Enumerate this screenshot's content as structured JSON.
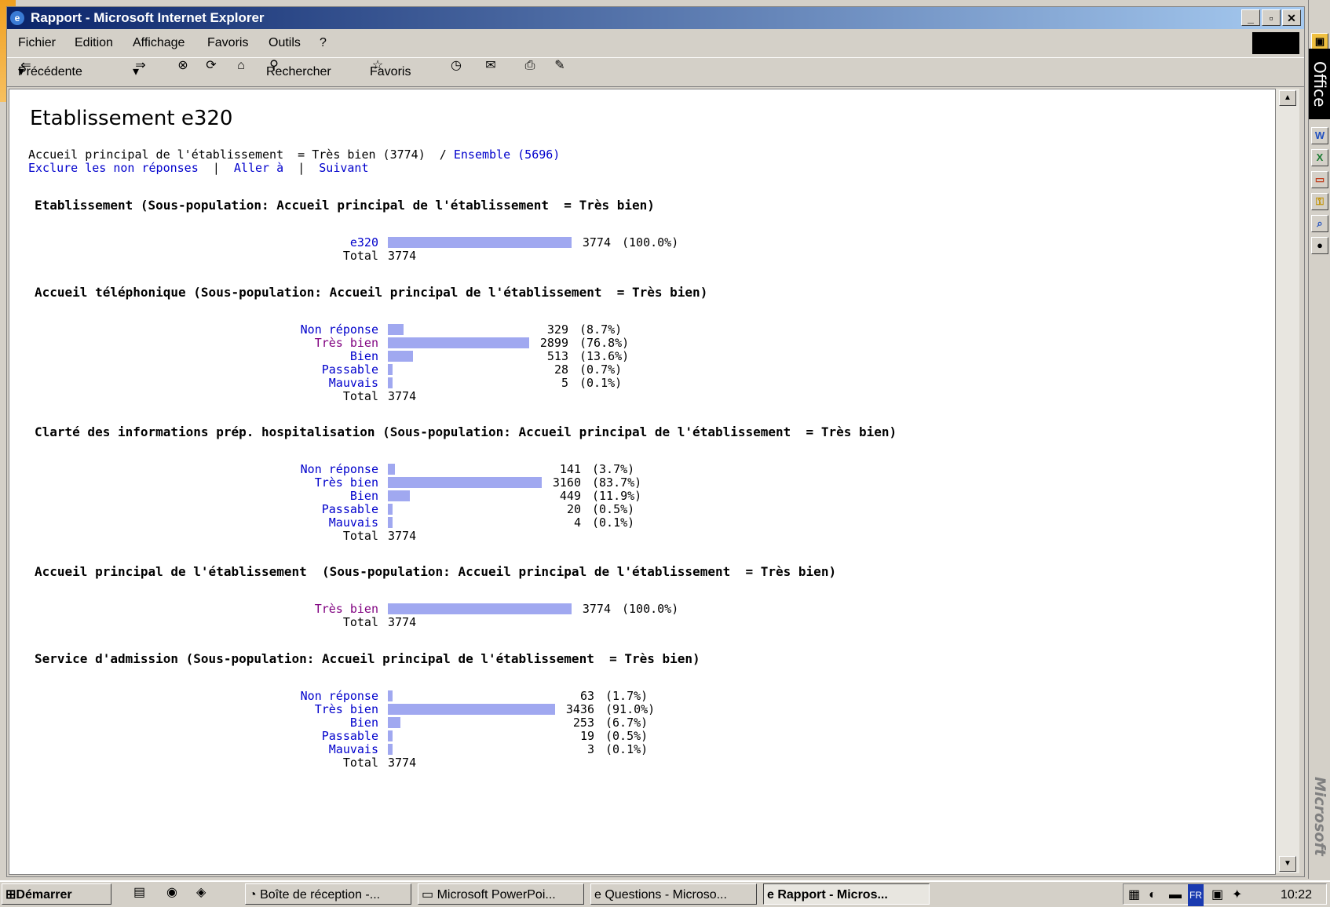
{
  "window": {
    "title": "Rapport - Microsoft Internet Explorer"
  },
  "menu": [
    "Fichier",
    "Edition",
    "Affichage",
    "Favoris",
    "Outils",
    "?"
  ],
  "toolbar": {
    "back": "Précédente",
    "search": "Rechercher",
    "favorites": "Favoris"
  },
  "report": {
    "heading": "Etablissement e320",
    "filter_text": "Accueil principal de l'établissement  = Très bien (3774)  /",
    "ensemble_link": "Ensemble (5696)",
    "links": {
      "exclude": "Exclure les non réponses",
      "sep1": "|",
      "goto": "Aller à",
      "sep2": "|",
      "next": "Suivant"
    },
    "total_label": "Total",
    "sections": [
      {
        "title": "Etablissement (Sous-population: Accueil principal de l'établissement  = Très bien)",
        "rows": [
          {
            "label": "e320",
            "count": "3774",
            "pct": "(100.0%)",
            "value": 100.0,
            "visited": false
          }
        ],
        "total": "3774"
      },
      {
        "title": "Accueil téléphonique (Sous-population: Accueil principal de l'établissement  = Très bien)",
        "rows": [
          {
            "label": "Non réponse",
            "count": "329",
            "pct": "(8.7%)",
            "value": 8.7,
            "visited": false
          },
          {
            "label": "Très bien",
            "count": "2899",
            "pct": "(76.8%)",
            "value": 76.8,
            "visited": true
          },
          {
            "label": "Bien",
            "count": "513",
            "pct": "(13.6%)",
            "value": 13.6,
            "visited": false
          },
          {
            "label": "Passable",
            "count": "28",
            "pct": "(0.7%)",
            "value": 0.7,
            "visited": false
          },
          {
            "label": "Mauvais",
            "count": "5",
            "pct": "(0.1%)",
            "value": 0.1,
            "visited": false
          }
        ],
        "total": "3774"
      },
      {
        "title": "Clarté des informations prép. hospitalisation (Sous-population: Accueil principal de l'établissement  = Très bien)",
        "rows": [
          {
            "label": "Non réponse",
            "count": "141",
            "pct": "(3.7%)",
            "value": 3.7,
            "visited": false
          },
          {
            "label": "Très bien",
            "count": "3160",
            "pct": "(83.7%)",
            "value": 83.7,
            "visited": false
          },
          {
            "label": "Bien",
            "count": "449",
            "pct": "(11.9%)",
            "value": 11.9,
            "visited": false
          },
          {
            "label": "Passable",
            "count": "20",
            "pct": "(0.5%)",
            "value": 0.5,
            "visited": false
          },
          {
            "label": "Mauvais",
            "count": "4",
            "pct": "(0.1%)",
            "value": 0.1,
            "visited": false
          }
        ],
        "total": "3774"
      },
      {
        "title": "Accueil principal de l'établissement  (Sous-population: Accueil principal de l'établissement  = Très bien)",
        "rows": [
          {
            "label": "Très bien",
            "count": "3774",
            "pct": "(100.0%)",
            "value": 100.0,
            "visited": true
          }
        ],
        "total": "3774"
      },
      {
        "title": "Service d'admission (Sous-population: Accueil principal de l'établissement  = Très bien)",
        "rows": [
          {
            "label": "Non réponse",
            "count": "63",
            "pct": "(1.7%)",
            "value": 1.7,
            "visited": false
          },
          {
            "label": "Très bien",
            "count": "3436",
            "pct": "(91.0%)",
            "value": 91.0,
            "visited": false
          },
          {
            "label": "Bien",
            "count": "253",
            "pct": "(6.7%)",
            "value": 6.7,
            "visited": false
          },
          {
            "label": "Passable",
            "count": "19",
            "pct": "(0.5%)",
            "value": 0.5,
            "visited": false
          },
          {
            "label": "Mauvais",
            "count": "3",
            "pct": "(0.1%)",
            "value": 0.1,
            "visited": false
          }
        ],
        "total": "3774"
      }
    ]
  },
  "taskbar": {
    "start": "Démarrer",
    "tasks": [
      "Boîte de réception -...",
      "Microsoft PowerPoi...",
      "Questions - Microso...",
      "Rapport - Micros..."
    ],
    "lang": "FR",
    "clock": "10:22"
  },
  "office_bar": {
    "title": "Office",
    "brand": "Microsoft"
  },
  "colors": {
    "bar": "#a0a8f0",
    "link": "#0000cc",
    "visited": "#800080",
    "titlebar": "#0a246a"
  }
}
